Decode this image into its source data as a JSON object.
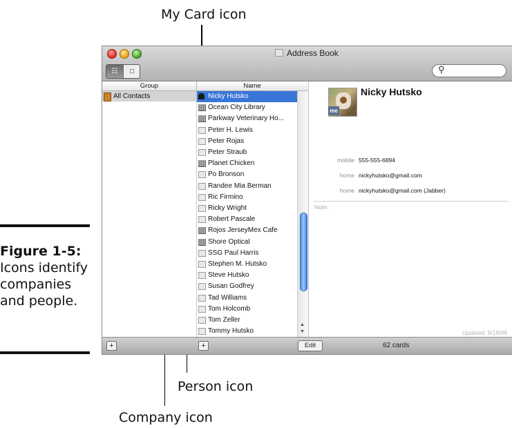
{
  "callouts": {
    "my_card": "My Card icon",
    "person": "Person icon",
    "company": "Company icon"
  },
  "figure": {
    "label": "Figure 1-5:",
    "caption": "Icons identify companies and people."
  },
  "window": {
    "title": "Address Book",
    "search_icon": "search-icon",
    "column_headers": {
      "group": "Group",
      "name": "Name"
    },
    "groups": [
      {
        "label": "All Contacts",
        "icon": "group-card-icon"
      }
    ],
    "contacts": [
      {
        "name": "Nicky Hutsko",
        "type": "my-card",
        "selected": true
      },
      {
        "name": "Ocean City Library",
        "type": "company"
      },
      {
        "name": "Parkway Veterinary Ho...",
        "type": "company"
      },
      {
        "name": "Peter H. Lewis",
        "type": "person"
      },
      {
        "name": "Peter Rojas",
        "type": "person"
      },
      {
        "name": "Peter Straub",
        "type": "person"
      },
      {
        "name": "Planet Chicken",
        "type": "company"
      },
      {
        "name": "Po Bronson",
        "type": "person"
      },
      {
        "name": "Randee Mia Berman",
        "type": "person"
      },
      {
        "name": "Ric Firmino",
        "type": "person"
      },
      {
        "name": "Ricky Wright",
        "type": "person"
      },
      {
        "name": "Robert Pascale",
        "type": "person"
      },
      {
        "name": "Rojos JerseyMex Cafe",
        "type": "company"
      },
      {
        "name": "Shore Optical",
        "type": "company"
      },
      {
        "name": "SSG Paul Harris",
        "type": "person"
      },
      {
        "name": "Stephen M. Hutsko",
        "type": "person"
      },
      {
        "name": "Steve Hutsko",
        "type": "person"
      },
      {
        "name": "Susan Godfrey",
        "type": "person"
      },
      {
        "name": "Tad Williams",
        "type": "person"
      },
      {
        "name": "Tom Holcomb",
        "type": "person"
      },
      {
        "name": "Tom Zeller",
        "type": "person"
      },
      {
        "name": "Tommy Hutsko",
        "type": "person"
      }
    ],
    "card": {
      "name": "Nicky Hutsko",
      "me_badge": "me",
      "fields": [
        {
          "label": "mobile",
          "value": "555-555-6894"
        },
        {
          "label": "home",
          "value": "nickyhutsko@gmail.com"
        },
        {
          "label": "home",
          "value": "nickyhutsko@gmail.com (Jabber)"
        }
      ],
      "note_label": "Note:",
      "updated": "Updated: 9/16/09"
    },
    "bottom": {
      "add_group": "+",
      "add_contact": "+",
      "edit": "Edit",
      "count": "62 cards"
    }
  }
}
